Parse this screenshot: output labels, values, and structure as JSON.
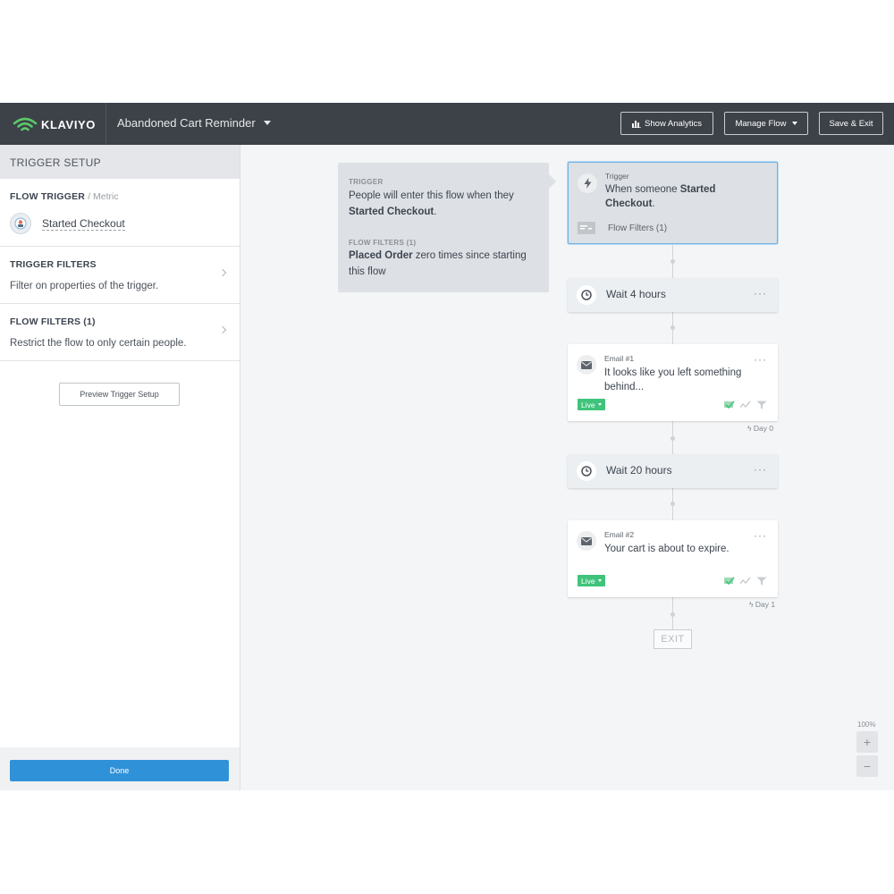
{
  "topbar": {
    "logo_text": "KLAVIYO",
    "flow_name": "Abandoned Cart Reminder",
    "show_analytics": "Show Analytics",
    "manage_flow": "Manage Flow",
    "save_exit": "Save & Exit"
  },
  "sidebar": {
    "header": "TRIGGER SETUP",
    "flow_trigger": {
      "title": "FLOW TRIGGER",
      "subtitle": "/ Metric",
      "metric_name": "Started Checkout"
    },
    "trigger_filters": {
      "title": "TRIGGER FILTERS",
      "description": "Filter on properties of the trigger."
    },
    "flow_filters": {
      "title": "FLOW FILTERS (1)",
      "description": "Restrict the flow to only certain people."
    },
    "preview_button": "Preview Trigger Setup",
    "done_button": "Done"
  },
  "info_card": {
    "trigger_label": "TRIGGER",
    "trigger_text_pre": "People will enter this flow when they ",
    "trigger_text_bold": "Started Checkout",
    "trigger_text_post": ".",
    "filters_label": "FLOW FILTERS (1)",
    "filters_text_bold": "Placed Order",
    "filters_text_post": " zero times since starting this flow"
  },
  "flow": {
    "trigger": {
      "label": "Trigger",
      "text_pre": "When someone ",
      "text_bold": "Started Checkout",
      "text_post": ".",
      "filters": "Flow Filters (1)"
    },
    "wait1": {
      "label": "Wait 4 hours"
    },
    "email1": {
      "label": "Email #1",
      "subject": "It looks like you left something behind...",
      "status": "Live",
      "day": "Day 0"
    },
    "wait2": {
      "label": "Wait 20 hours"
    },
    "email2": {
      "label": "Email #2",
      "subject": "Your cart is about to expire.",
      "status": "Live",
      "day": "Day 1"
    },
    "exit": "EXIT"
  },
  "zoom": {
    "level": "100%",
    "in": "+",
    "out": "−"
  },
  "menu_dots": "···",
  "day_prefix": "ϟ",
  "colors": {
    "topbar": "#3c4248",
    "accent_blue": "#2f92d8",
    "live_green": "#40c47c",
    "logo_green": "#5cc86a"
  }
}
